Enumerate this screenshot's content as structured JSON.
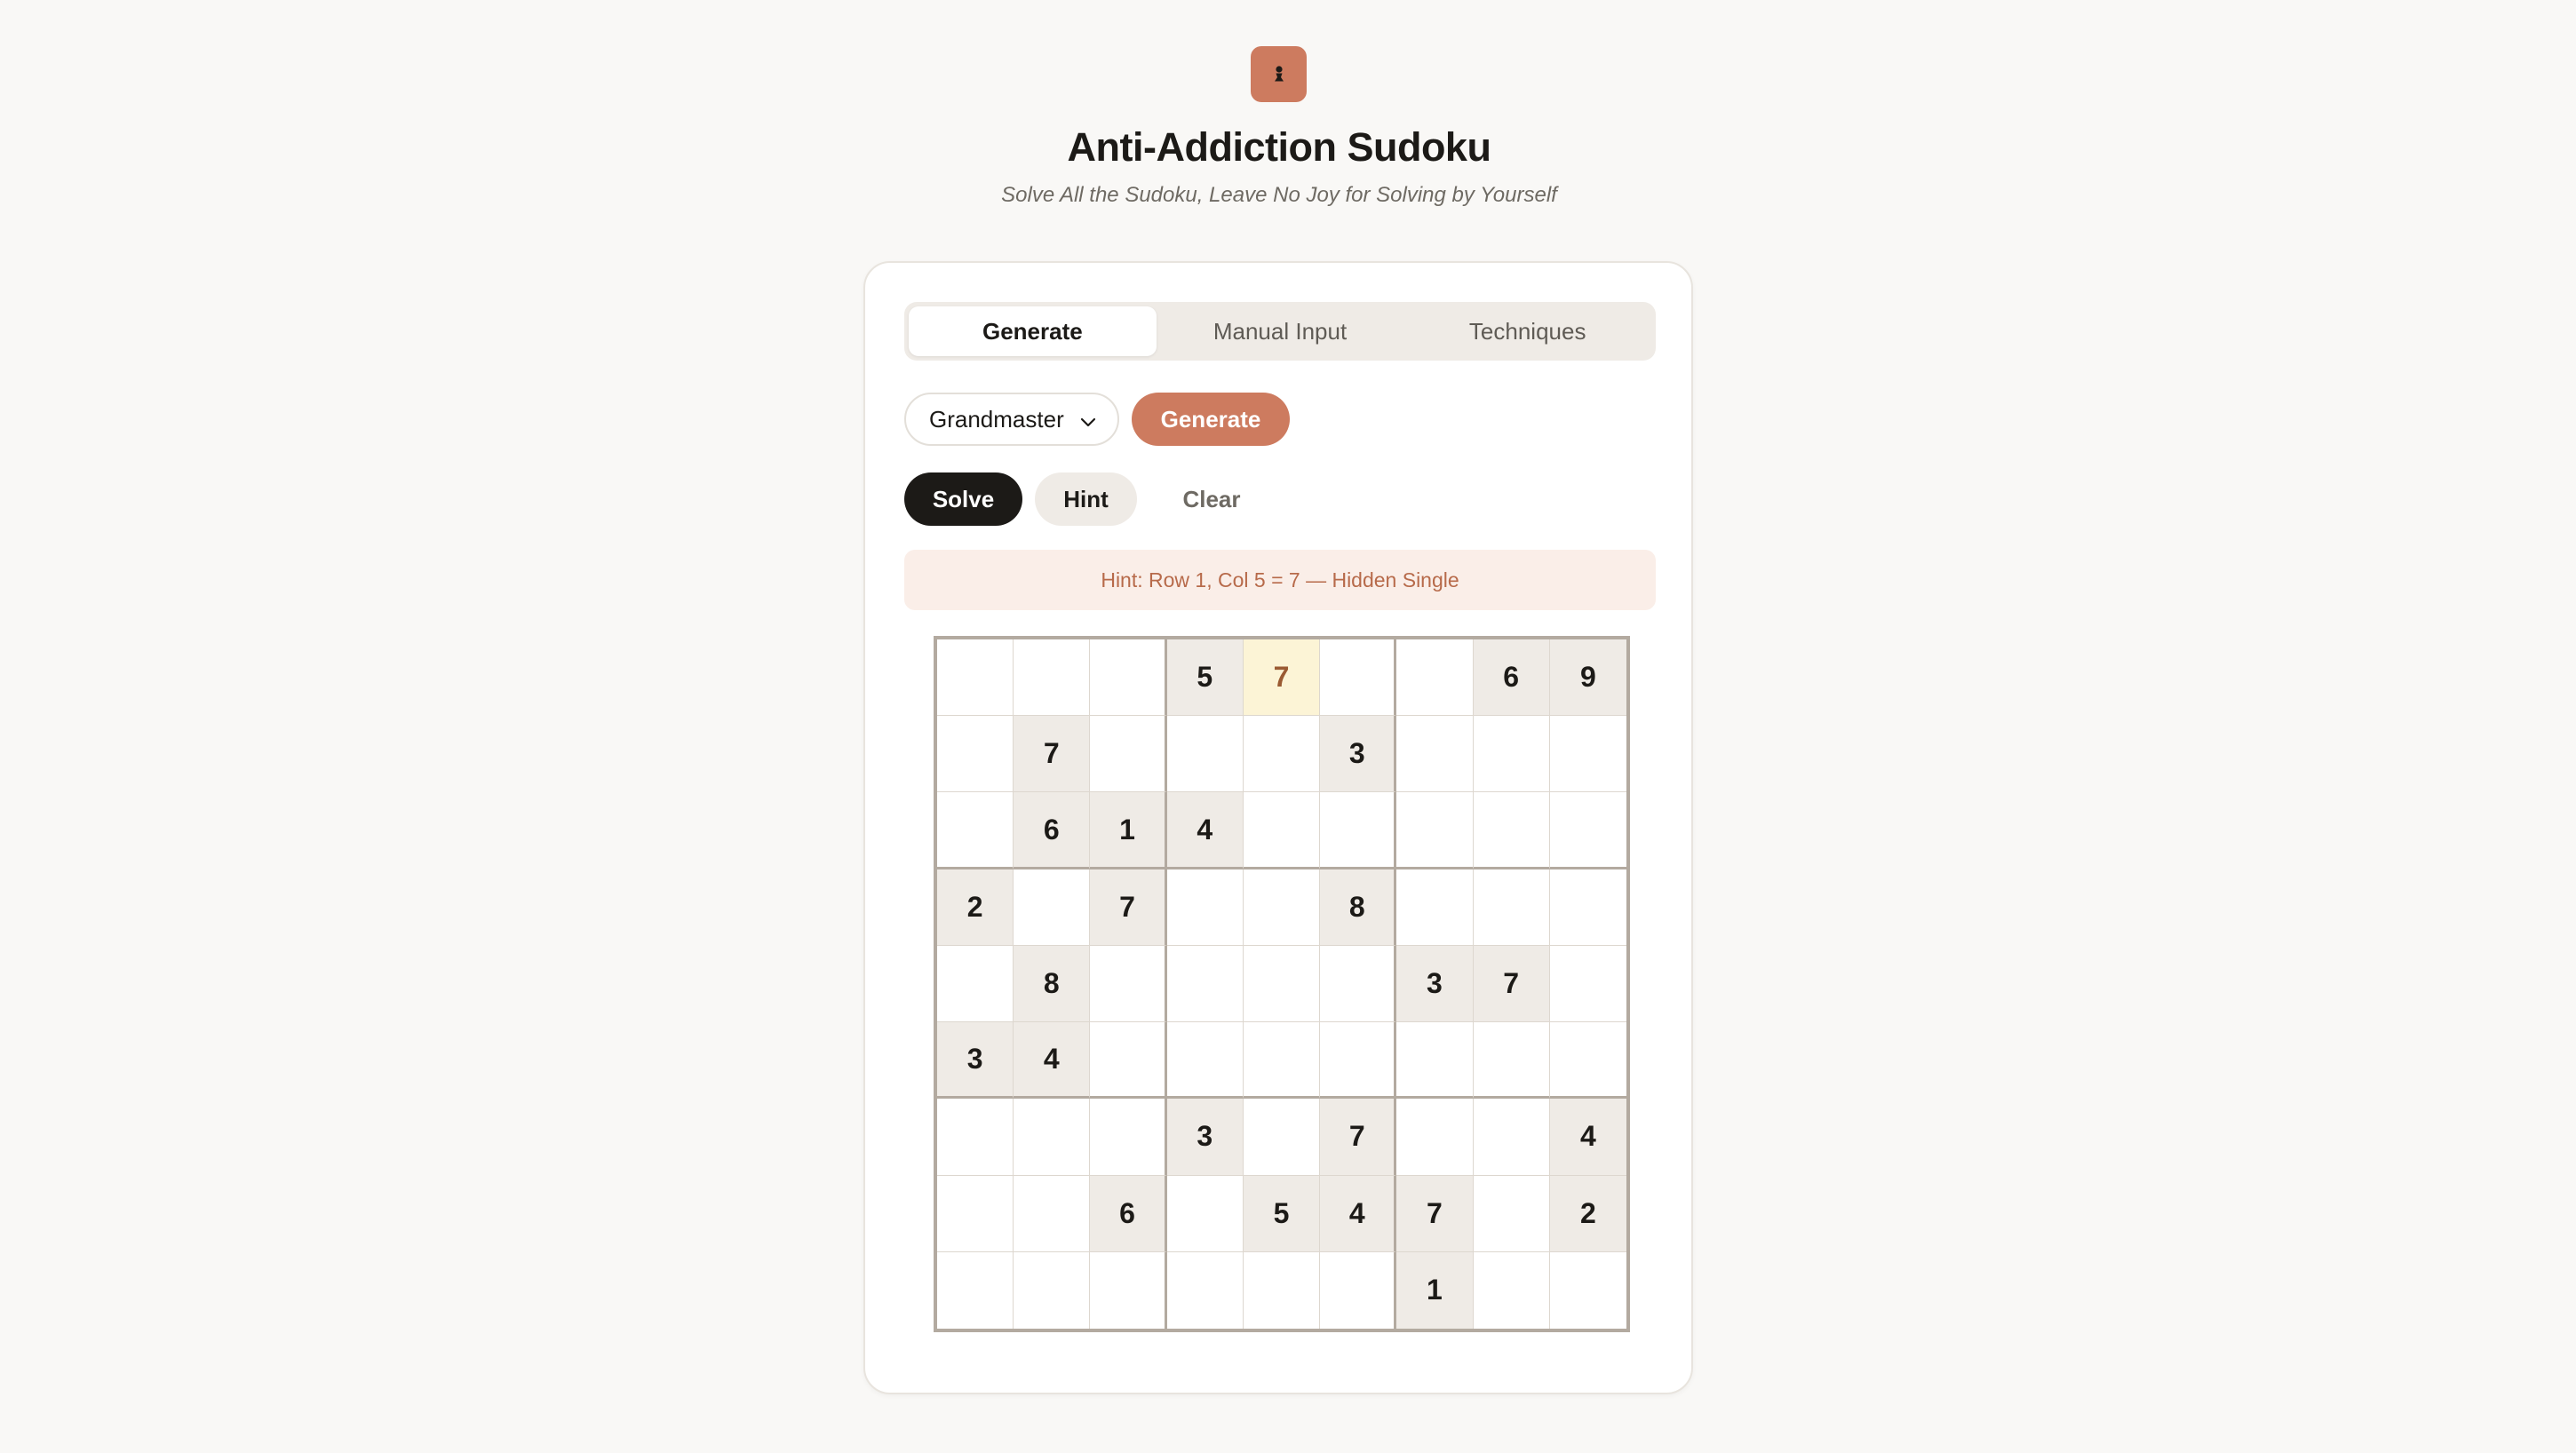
{
  "app": {
    "logo_icon": "pawn-icon",
    "title": "Anti-Addiction Sudoku",
    "subtitle": "Solve All the Sudoku, Leave No Joy for Solving by Yourself"
  },
  "tabs": [
    {
      "label": "Generate",
      "active": true
    },
    {
      "label": "Manual Input",
      "active": false
    },
    {
      "label": "Techniques",
      "active": false
    }
  ],
  "controls": {
    "difficulty": {
      "selected": "Grandmaster"
    },
    "generate_label": "Generate",
    "solve_label": "Solve",
    "hint_label": "Hint",
    "clear_label": "Clear"
  },
  "hint_message": "Hint: Row 1, Col 5 = 7 — Hidden Single",
  "colors": {
    "accent": "#cd7b5f",
    "given_bg": "#efebe6",
    "hint_bg": "#fcf4d6",
    "hint_text": "#9a5a32"
  },
  "board": {
    "hint_cell": {
      "row": 1,
      "col": 5,
      "value": "7"
    },
    "rows": [
      [
        "",
        "",
        "",
        "5",
        "7",
        "",
        "",
        "6",
        "9"
      ],
      [
        "",
        "7",
        "",
        "",
        "",
        "3",
        "",
        "",
        ""
      ],
      [
        "",
        "6",
        "1",
        "4",
        "",
        "",
        "",
        "",
        ""
      ],
      [
        "2",
        "",
        "7",
        "",
        "",
        "8",
        "",
        "",
        ""
      ],
      [
        "",
        "8",
        "",
        "",
        "",
        "",
        "3",
        "7",
        ""
      ],
      [
        "3",
        "4",
        "",
        "",
        "",
        "",
        "",
        "",
        ""
      ],
      [
        "",
        "",
        "",
        "3",
        "",
        "7",
        "",
        "",
        "4"
      ],
      [
        "",
        "",
        "6",
        "",
        "5",
        "4",
        "7",
        "",
        "2"
      ],
      [
        "",
        "",
        "",
        "",
        "",
        "",
        "1",
        "",
        ""
      ]
    ]
  }
}
